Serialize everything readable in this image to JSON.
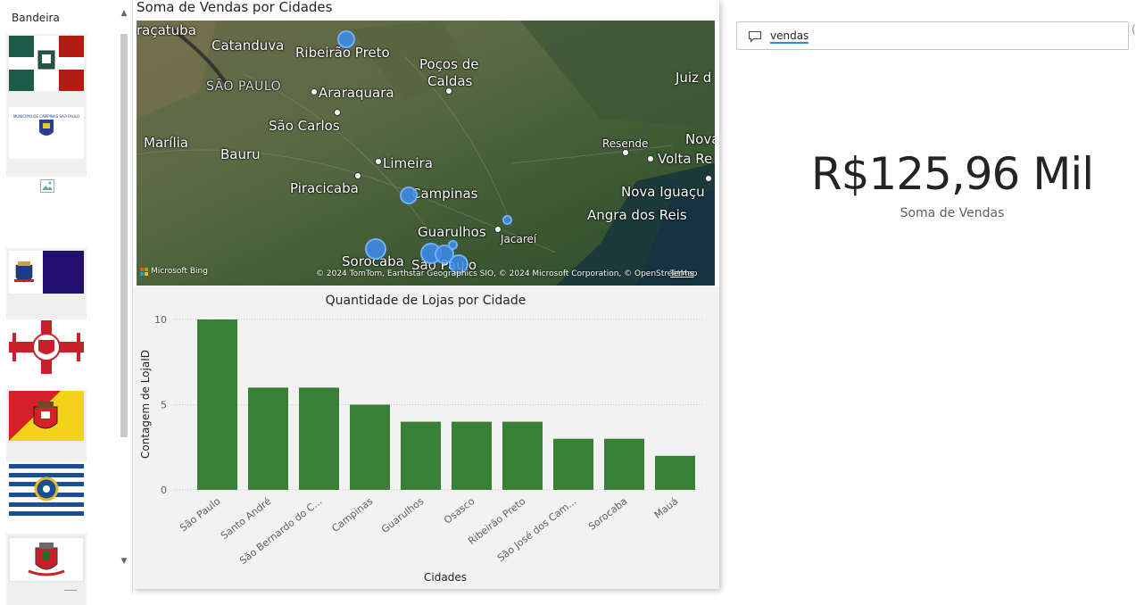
{
  "slicer": {
    "header": "Bandeira",
    "flags": [
      "municipal-flag-green-red",
      "municipal-seal-blue-text",
      "broken-image",
      "flag-emblem-navy",
      "flag-red-cross-white",
      "flag-red-yellow-diagonal",
      "flag-blue-white-stripes",
      "coat-of-arms"
    ],
    "seal_text": "MUNICIPIO DE CAMPINAS SAO PAULO"
  },
  "map": {
    "title": "Soma de Vendas por Cidades",
    "labels": [
      "raçatuba",
      "Catanduva",
      "Ribeirão Preto",
      "Poços de",
      "Caldas",
      "Juiz d",
      "SÃO PAULO",
      "Araraquara",
      "São Carlos",
      "Marília",
      "Bauru",
      "Resende",
      "Nova",
      "Volta Re",
      "Limeira",
      "Piracicaba",
      "Campinas",
      "Nova Iguaçu",
      "Angra dos Reis",
      "Guarulhos",
      "Jacareí",
      "Sorocaba",
      "São Paulo"
    ],
    "credit": "© 2024 TomTom, Earthstar Geographics SIO, © 2024 Microsoft Corporation, © OpenStreetMap",
    "terms": "Terms",
    "bing": "Microsoft Bing"
  },
  "chart_data": {
    "type": "bar",
    "title": "Quantidade de Lojas por Cidade",
    "xlabel": "Cidades",
    "ylabel": "Contagem de LojaID",
    "categories": [
      "São Paulo",
      "Santo André",
      "São Bernardo do C...",
      "Campinas",
      "Guarulhos",
      "Osasco",
      "Ribeirão Preto",
      "São José dos Cam...",
      "Sorocaba",
      "Mauá"
    ],
    "values": [
      10,
      6,
      6,
      5,
      4,
      4,
      4,
      3,
      3,
      2
    ],
    "yticks": [
      0,
      5,
      10
    ],
    "ylim": [
      0,
      10
    ],
    "color": "#3a7f36",
    "grid": true
  },
  "qa": {
    "text": "vendas"
  },
  "card": {
    "value": "R$125,96 Mil",
    "label": "Soma de Vendas"
  }
}
